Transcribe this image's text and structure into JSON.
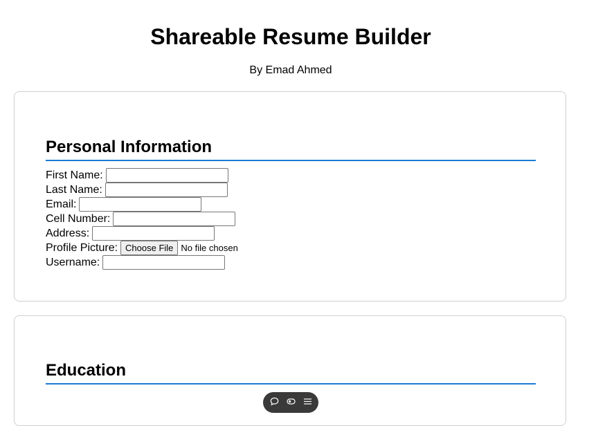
{
  "header": {
    "title": "Shareable Resume Builder",
    "byline": "By Emad Ahmed"
  },
  "personal": {
    "heading": "Personal Information",
    "fields": {
      "first_name": {
        "label": "First Name:",
        "value": ""
      },
      "last_name": {
        "label": "Last Name:",
        "value": ""
      },
      "email": {
        "label": "Email:",
        "value": ""
      },
      "cell_number": {
        "label": "Cell Number:",
        "value": ""
      },
      "address": {
        "label": "Address:",
        "value": ""
      },
      "profile_picture": {
        "label": "Profile Picture:",
        "button_label": "Choose File",
        "status": "No file chosen"
      },
      "username": {
        "label": "Username:",
        "value": ""
      }
    }
  },
  "education": {
    "heading": "Education"
  },
  "toolbar": {
    "icons": [
      "comment-icon",
      "toggle-icon",
      "menu-icon"
    ]
  },
  "colors": {
    "accent": "#1a7ad4",
    "card_border": "#cfcfcf",
    "toolbar_bg": "#3a3a3a"
  }
}
